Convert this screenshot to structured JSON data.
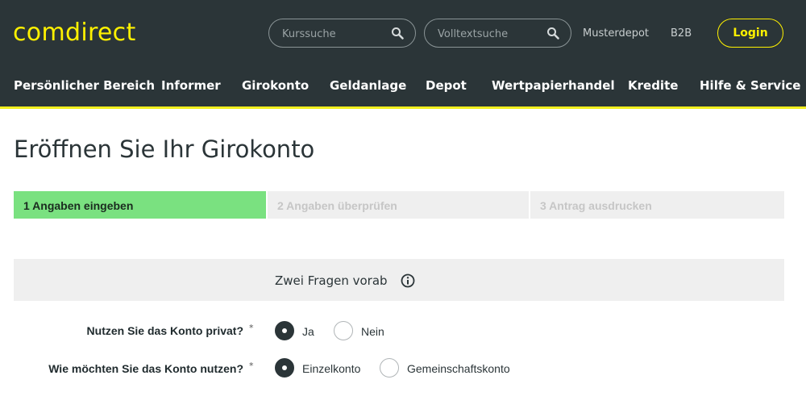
{
  "header": {
    "logo": "comdirect",
    "search_kurs": {
      "placeholder": "Kurssuche"
    },
    "search_volltext": {
      "placeholder": "Volltextsuche"
    },
    "links": [
      "Musterdepot",
      "B2B"
    ],
    "login_label": "Login",
    "colors": {
      "background": "#2b3538",
      "brand_yellow": "#fff100"
    }
  },
  "nav": [
    "Persönlicher Bereich",
    "Informer",
    "Girokonto",
    "Geldanlage",
    "Depot",
    "Wertpapierhandel",
    "Kredite",
    "Hilfe & Service"
  ],
  "page": {
    "title": "Eröffnen Sie Ihr Girokonto"
  },
  "steps": [
    {
      "label": "1 Angaben eingeben",
      "active": true
    },
    {
      "label": "2 Angaben überprüfen",
      "active": false
    },
    {
      "label": "3 Antrag ausdrucken",
      "active": false
    }
  ],
  "section": {
    "title": "Zwei Fragen vorab",
    "icon": "info-icon"
  },
  "questions": [
    {
      "label": "Nutzen Sie das Konto privat?",
      "required_mark": "*",
      "options": [
        {
          "label": "Ja",
          "selected": true
        },
        {
          "label": "Nein",
          "selected": false
        }
      ]
    },
    {
      "label": "Wie möchten Sie das Konto nutzen?",
      "required_mark": "*",
      "options": [
        {
          "label": "Einzelkonto",
          "selected": true
        },
        {
          "label": "Gemeinschaftskonto",
          "selected": false
        }
      ]
    }
  ]
}
